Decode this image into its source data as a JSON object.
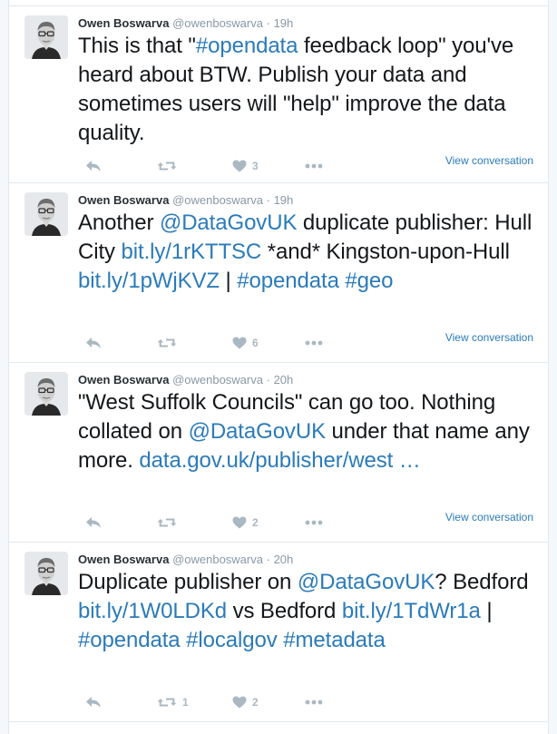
{
  "colors": {
    "link": "#2b7bb9",
    "muted": "#8899a6",
    "icon": "#aab8c2",
    "border": "#e1e8ed"
  },
  "tweets": [
    {
      "fullname": "Owen Boswarva",
      "username": "@owenboswarva",
      "dot": "·",
      "time": "19h",
      "segments": [
        {
          "t": "This is that \"",
          "link": false
        },
        {
          "t": "#opendata",
          "link": true
        },
        {
          "t": " feedback loop\" you've heard about BTW. Publish your data and sometimes users will \"help\" improve the data quality.",
          "link": false
        }
      ],
      "actions": {
        "reply_icon": "reply-icon",
        "retweet_icon": "retweet-icon",
        "retweet_count": "",
        "like_icon": "heart-icon",
        "like_count": "3",
        "more_icon": "more-icon"
      },
      "view_conversation": "View conversation"
    },
    {
      "fullname": "Owen Boswarva",
      "username": "@owenboswarva",
      "dot": "·",
      "time": "19h",
      "segments": [
        {
          "t": "Another ",
          "link": false
        },
        {
          "t": "@DataGovUK",
          "link": true
        },
        {
          "t": " duplicate publisher: Hull City ",
          "link": false
        },
        {
          "t": "bit.ly/1rKTTSC",
          "link": true
        },
        {
          "t": " *and* Kingston-upon-Hull ",
          "link": false
        },
        {
          "t": "bit.ly/1pWjKVZ",
          "link": true
        },
        {
          "t": " | ",
          "link": false
        },
        {
          "t": "#opendata",
          "link": true
        },
        {
          "t": " ",
          "link": false
        },
        {
          "t": "#geo",
          "link": true
        }
      ],
      "actions": {
        "reply_icon": "reply-icon",
        "retweet_icon": "retweet-icon",
        "retweet_count": "",
        "like_icon": "heart-icon",
        "like_count": "6",
        "more_icon": "more-icon"
      },
      "view_conversation": "View conversation"
    },
    {
      "fullname": "Owen Boswarva",
      "username": "@owenboswarva",
      "dot": "·",
      "time": "20h",
      "segments": [
        {
          "t": "\"West Suffolk Councils\" can go too. Nothing collated on ",
          "link": false
        },
        {
          "t": "@DataGovUK",
          "link": true
        },
        {
          "t": " under that name any more. ",
          "link": false
        },
        {
          "t": "data.gov.uk/publisher/west …",
          "link": true
        }
      ],
      "actions": {
        "reply_icon": "reply-icon",
        "retweet_icon": "retweet-icon",
        "retweet_count": "",
        "like_icon": "heart-icon",
        "like_count": "2",
        "more_icon": "more-icon"
      },
      "view_conversation": "View conversation"
    },
    {
      "fullname": "Owen Boswarva",
      "username": "@owenboswarva",
      "dot": "·",
      "time": "20h",
      "segments": [
        {
          "t": "Duplicate publisher on ",
          "link": false
        },
        {
          "t": "@DataGovUK",
          "link": true
        },
        {
          "t": "? Bedford ",
          "link": false
        },
        {
          "t": "bit.ly/1W0LDKd",
          "link": true
        },
        {
          "t": " vs Bedford ",
          "link": false
        },
        {
          "t": "bit.ly/1TdWr1a",
          "link": true
        },
        {
          "t": " | ",
          "link": false
        },
        {
          "t": "#opendata",
          "link": true
        },
        {
          "t": " ",
          "link": false
        },
        {
          "t": "#localgov",
          "link": true
        },
        {
          "t": " ",
          "link": false
        },
        {
          "t": "#metadata",
          "link": true
        }
      ],
      "actions": {
        "reply_icon": "reply-icon",
        "retweet_icon": "retweet-icon",
        "retweet_count": "1",
        "like_icon": "heart-icon",
        "like_count": "2",
        "more_icon": "more-icon"
      },
      "view_conversation": ""
    }
  ]
}
